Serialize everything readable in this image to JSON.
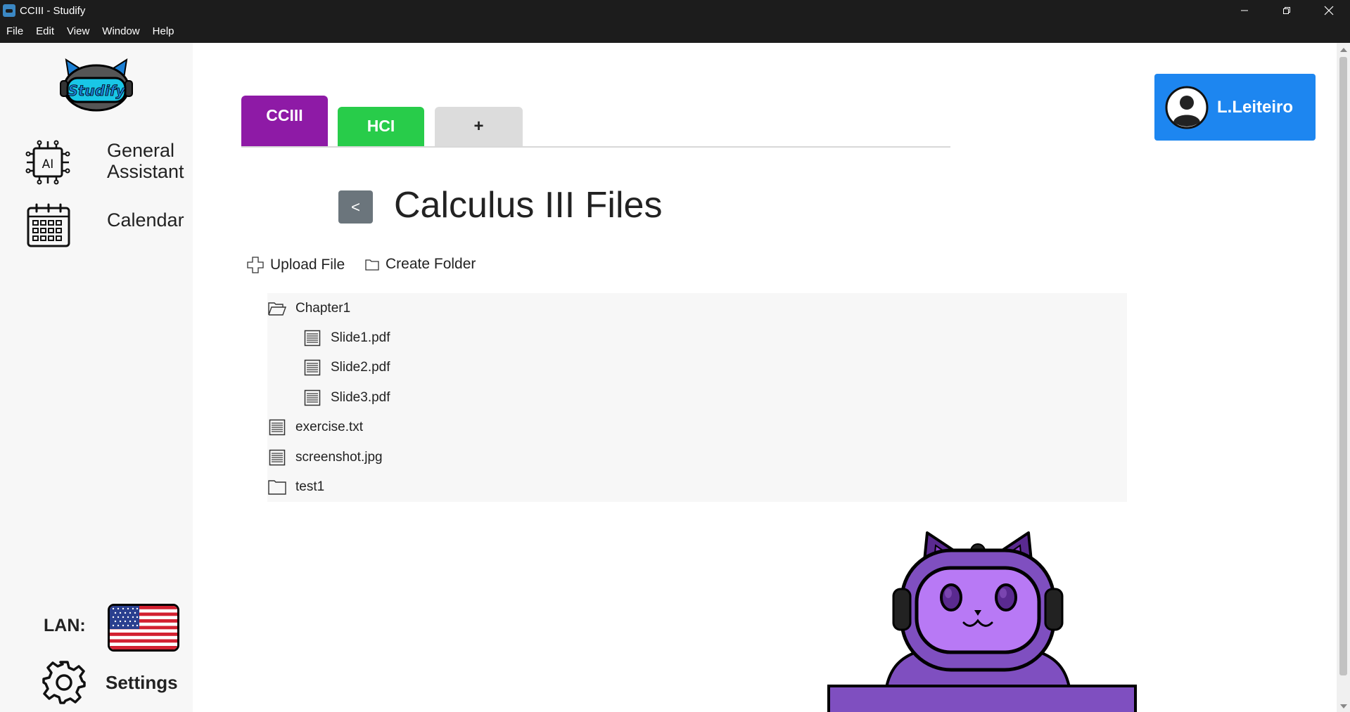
{
  "window": {
    "title": "CCIII - Studify",
    "menus": [
      "File",
      "Edit",
      "View",
      "Window",
      "Help"
    ],
    "controls": [
      "minimize-icon",
      "restore-icon",
      "close-icon"
    ]
  },
  "sidebar": {
    "logo_text": "Studify",
    "items": [
      {
        "label_line1": "General",
        "label_line2": "Assistant",
        "icon": "ai-chip-icon"
      },
      {
        "label": "Calendar",
        "icon": "calendar-icon"
      }
    ],
    "lan_label": "LAN:",
    "language_flag": "us-flag-icon",
    "settings_label": "Settings"
  },
  "tabs": [
    {
      "label": "CCIII",
      "color": "#8e1aa6",
      "active": true
    },
    {
      "label": "HCI",
      "color": "#28cc4a",
      "active": false
    },
    {
      "label": "+",
      "color": "#dcdcdc",
      "active": false
    }
  ],
  "user": {
    "name": "L.Leiteiro"
  },
  "main": {
    "back_label": "<",
    "title": "Calculus III Files",
    "actions": {
      "upload": "Upload File",
      "create_folder": "Create Folder"
    }
  },
  "files": [
    {
      "name": "Chapter1",
      "type": "folder-open",
      "depth": 0
    },
    {
      "name": "Slide1.pdf",
      "type": "file",
      "depth": 1
    },
    {
      "name": "Slide2.pdf",
      "type": "file",
      "depth": 1
    },
    {
      "name": "Slide3.pdf",
      "type": "file",
      "depth": 1
    },
    {
      "name": "exercise.txt",
      "type": "file",
      "depth": 0
    },
    {
      "name": "screenshot.jpg",
      "type": "file",
      "depth": 0
    },
    {
      "name": "test1",
      "type": "folder",
      "depth": 0
    }
  ],
  "colors": {
    "accent_blue": "#1d86f0",
    "cciii_purple": "#8e1aa6",
    "hci_green": "#28cc4a",
    "mascot_purple": "#7f4fc0"
  }
}
